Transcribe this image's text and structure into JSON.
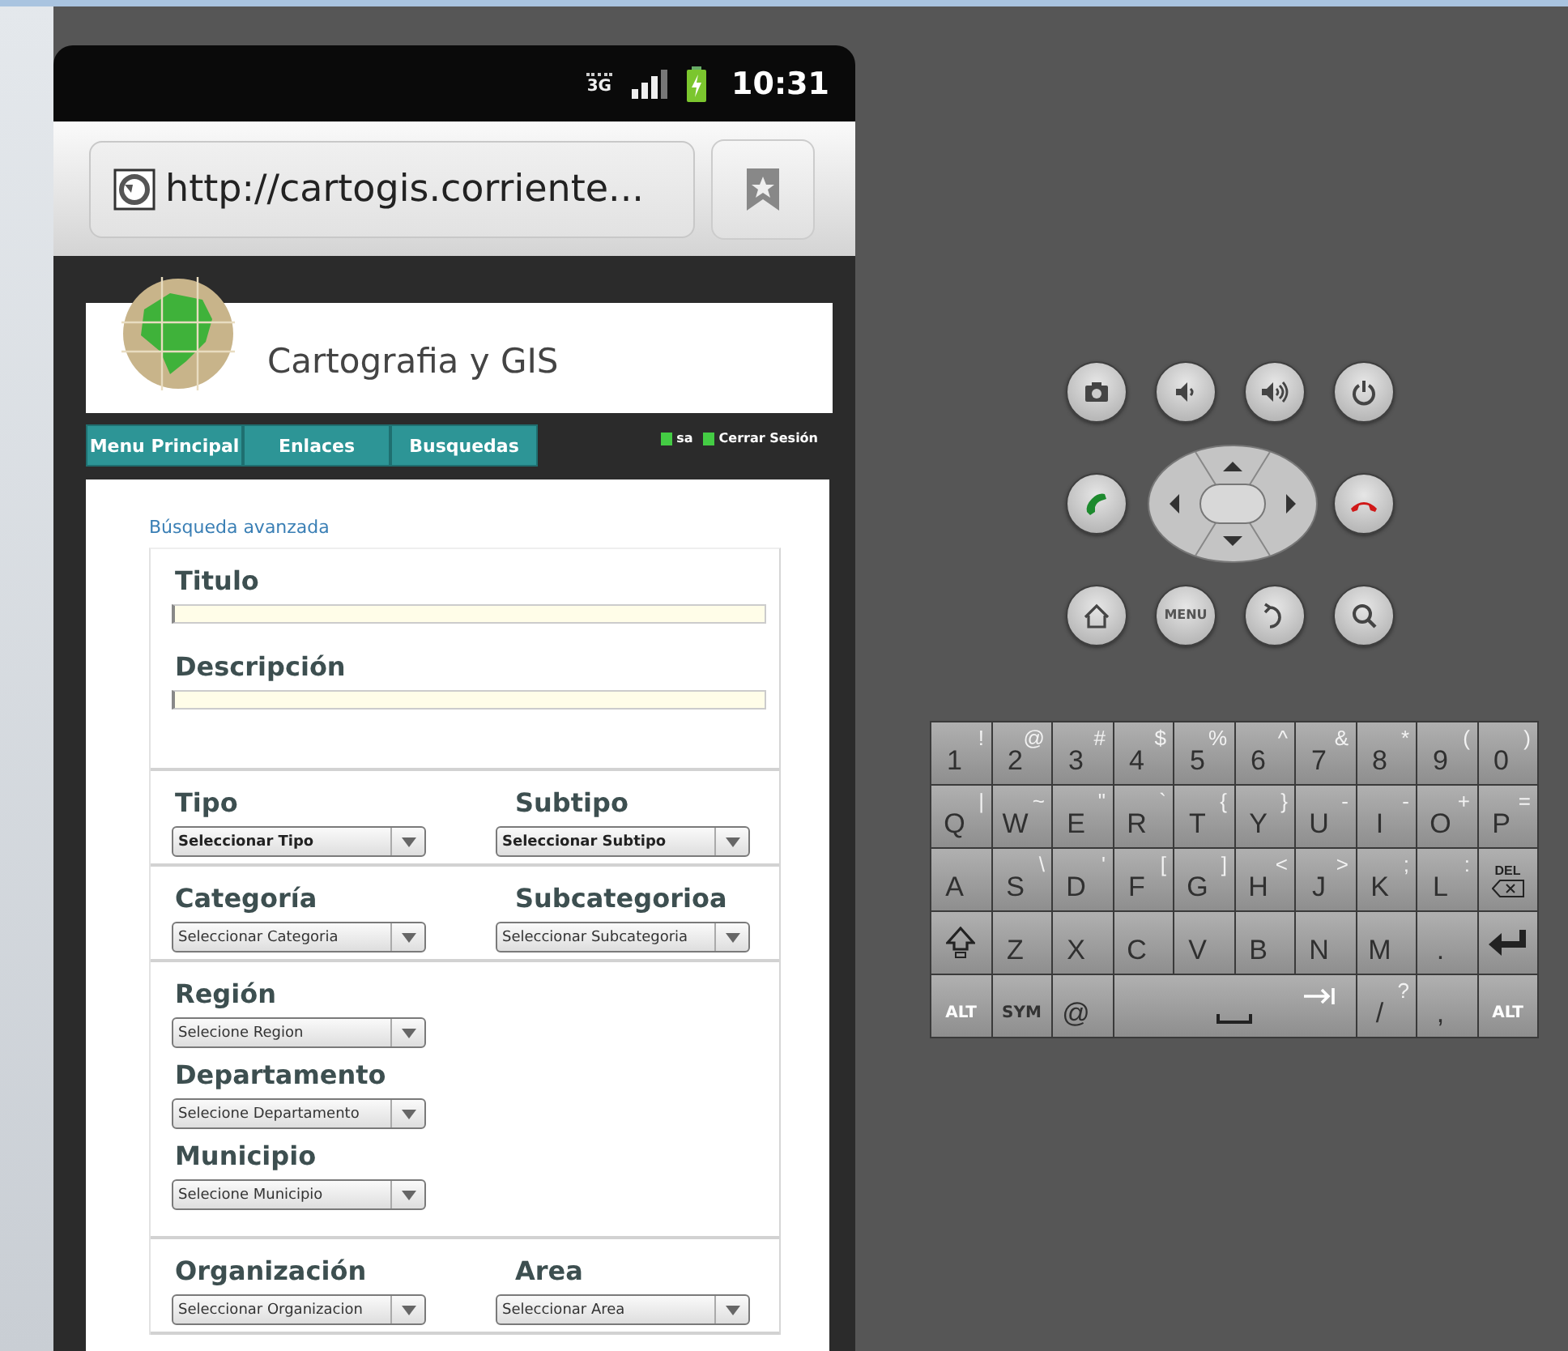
{
  "status_bar": {
    "network": "3G",
    "time": "10:31"
  },
  "browser": {
    "url": "http://cartogis.corriente..."
  },
  "site": {
    "title": "Cartografia y GIS",
    "nav": [
      {
        "label": "Menu Principal",
        "selected": false
      },
      {
        "label": "Enlaces",
        "selected": false
      },
      {
        "label": "Busquedas",
        "selected": false
      }
    ],
    "user_links": [
      "sa",
      "Cerrar Sesión"
    ]
  },
  "form": {
    "heading": "Búsqueda avanzada",
    "sections": [
      {
        "rows": [
          [
            {
              "kind": "text",
              "label": "Titulo"
            }
          ],
          [
            {
              "kind": "text",
              "label": "Descripción"
            }
          ]
        ]
      },
      {
        "rows": [
          [
            {
              "kind": "select",
              "label": "Tipo",
              "value": "Seleccionar Tipo",
              "bold": true
            },
            {
              "kind": "select",
              "label": "Subtipo",
              "value": "Seleccionar Subtipo",
              "bold": true
            }
          ]
        ]
      },
      {
        "rows": [
          [
            {
              "kind": "select",
              "label": "Categoría",
              "value": "Seleccionar Categoria",
              "bold": false
            },
            {
              "kind": "select",
              "label": "Subcategorioa",
              "value": "Seleccionar Subcategoria",
              "bold": false
            }
          ]
        ]
      },
      {
        "rows": [
          [
            {
              "kind": "select",
              "label": "Región",
              "value": "Selecione Region",
              "bold": false
            }
          ],
          [
            {
              "kind": "select",
              "label": "Departamento",
              "value": "Selecione Departamento",
              "bold": false
            }
          ],
          [
            {
              "kind": "select",
              "label": "Municipio",
              "value": "Selecione Municipio",
              "bold": false
            }
          ]
        ]
      },
      {
        "rows": [
          [
            {
              "kind": "select",
              "label": "Organización",
              "value": "Seleccionar Organizacion",
              "bold": false
            },
            {
              "kind": "select",
              "label": "Area",
              "value": "Seleccionar Area",
              "bold": false
            }
          ]
        ]
      }
    ]
  },
  "hardware_buttons": [
    {
      "kind": "camera"
    },
    {
      "kind": "volume_down"
    },
    {
      "kind": "volume_up"
    },
    {
      "kind": "power"
    },
    {
      "kind": "call"
    },
    {
      "kind": "dpad"
    },
    {
      "kind": "end_call"
    },
    {
      "kind": "home"
    },
    {
      "kind": "menu",
      "label": "MENU"
    },
    {
      "kind": "back"
    },
    {
      "kind": "search"
    }
  ],
  "keyboard": {
    "rows": [
      [
        {
          "kind": "char",
          "main": "1",
          "alt": "!"
        },
        {
          "kind": "char",
          "main": "2",
          "alt": "@"
        },
        {
          "kind": "char",
          "main": "3",
          "alt": "#"
        },
        {
          "kind": "char",
          "main": "4",
          "alt": "$"
        },
        {
          "kind": "char",
          "main": "5",
          "alt": "%"
        },
        {
          "kind": "char",
          "main": "6",
          "alt": "^"
        },
        {
          "kind": "char",
          "main": "7",
          "alt": "&"
        },
        {
          "kind": "char",
          "main": "8",
          "alt": "*"
        },
        {
          "kind": "char",
          "main": "9",
          "alt": "("
        },
        {
          "kind": "char",
          "main": "0",
          "alt": ")"
        }
      ],
      [
        {
          "kind": "char",
          "main": "Q",
          "alt": "|"
        },
        {
          "kind": "char",
          "main": "W",
          "alt": "~"
        },
        {
          "kind": "char",
          "main": "E",
          "alt": "\""
        },
        {
          "kind": "char",
          "main": "R",
          "alt": "`"
        },
        {
          "kind": "char",
          "main": "T",
          "alt": "{"
        },
        {
          "kind": "char",
          "main": "Y",
          "alt": "}"
        },
        {
          "kind": "char",
          "main": "U",
          "alt": "-"
        },
        {
          "kind": "char",
          "main": "I",
          "alt": "-"
        },
        {
          "kind": "char",
          "main": "O",
          "alt": "+"
        },
        {
          "kind": "char",
          "main": "P",
          "alt": "="
        }
      ],
      [
        {
          "kind": "char",
          "main": "A"
        },
        {
          "kind": "char",
          "main": "S",
          "alt": "\\"
        },
        {
          "kind": "char",
          "main": "D",
          "alt": "'"
        },
        {
          "kind": "char",
          "main": "F",
          "alt": "["
        },
        {
          "kind": "char",
          "main": "G",
          "alt": "]"
        },
        {
          "kind": "char",
          "main": "H",
          "alt": "<"
        },
        {
          "kind": "char",
          "main": "J",
          "alt": ">"
        },
        {
          "kind": "char",
          "main": "K",
          "alt": ";"
        },
        {
          "kind": "char",
          "main": "L",
          "alt": ":"
        },
        {
          "kind": "delete",
          "main": "DEL"
        }
      ],
      [
        {
          "kind": "shift"
        },
        {
          "kind": "char",
          "main": "Z"
        },
        {
          "kind": "char",
          "main": "X"
        },
        {
          "kind": "char",
          "main": "C"
        },
        {
          "kind": "char",
          "main": "V"
        },
        {
          "kind": "char",
          "main": "B"
        },
        {
          "kind": "char",
          "main": "N"
        },
        {
          "kind": "char",
          "main": "M"
        },
        {
          "kind": "char",
          "main": "."
        },
        {
          "kind": "enter"
        }
      ]
    ],
    "bottom_keys": [
      {
        "kind": "mod",
        "main": "ALT"
      },
      {
        "kind": "mod",
        "main": "SYM"
      },
      {
        "kind": "char",
        "main": "@"
      },
      {
        "kind": "space"
      },
      {
        "kind": "char",
        "main": "/",
        "alt": "?"
      },
      {
        "kind": "char",
        "main": ","
      },
      {
        "kind": "mod",
        "main": "ALT"
      }
    ]
  }
}
